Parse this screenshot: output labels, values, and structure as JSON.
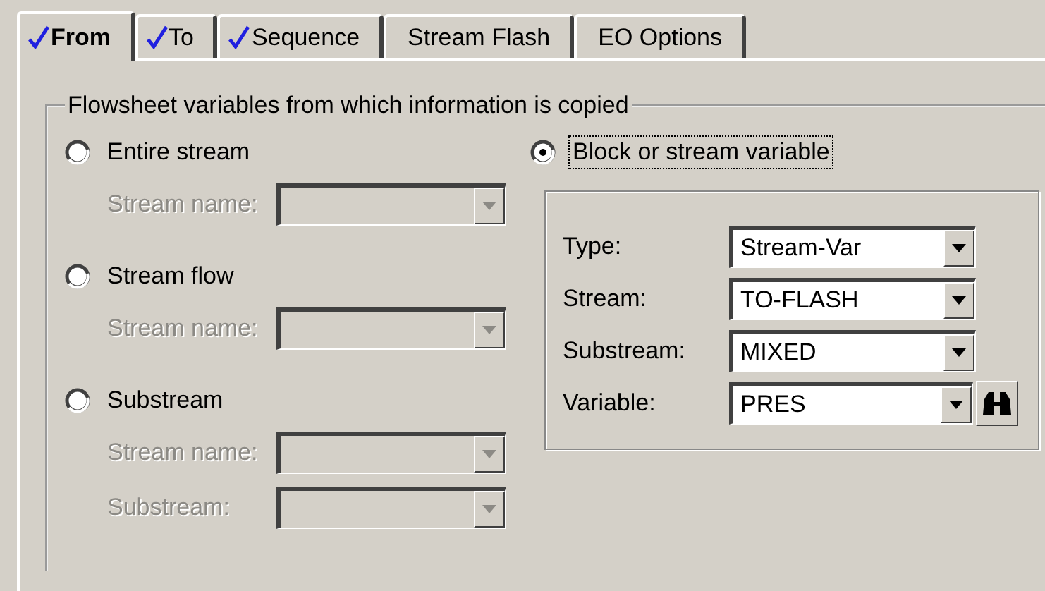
{
  "tabs": [
    {
      "label": "From",
      "selected": true,
      "complete": true
    },
    {
      "label": "To",
      "selected": false,
      "complete": true
    },
    {
      "label": "Sequence",
      "selected": false,
      "complete": true
    },
    {
      "label": "Stream Flash",
      "selected": false,
      "complete": false
    },
    {
      "label": "EO Options",
      "selected": false,
      "complete": false
    }
  ],
  "group": {
    "legend": "Flowsheet variables from which information is copied",
    "options": [
      {
        "kind": "plain",
        "label": "Entire stream",
        "selected": false,
        "fields": [
          {
            "label": "Stream name:",
            "disabled": true,
            "search": false
          }
        ]
      },
      {
        "kind": "plain",
        "label": "Stream flow",
        "selected": false,
        "fields": [
          {
            "label": "Stream name:",
            "disabled": true,
            "search": false
          }
        ]
      },
      {
        "kind": "plain",
        "label": "Substream",
        "selected": false,
        "fields": [
          {
            "label": "Stream name:",
            "disabled": true,
            "search": false
          },
          {
            "label": "Substream:",
            "disabled": true,
            "search": false
          }
        ]
      },
      {
        "kind": "framed",
        "label": "Block or stream variable",
        "selected": true,
        "fields": [
          {
            "label": "Type:",
            "value": "Stream-Var",
            "disabled": false,
            "search": false
          },
          {
            "label": "Stream:",
            "value": "TO-FLASH",
            "disabled": false,
            "search": false
          },
          {
            "label": "Substream:",
            "value": "MIXED",
            "disabled": false,
            "search": false
          },
          {
            "label": "Variable:",
            "value": "PRES",
            "disabled": false,
            "search": true
          }
        ]
      }
    ]
  }
}
